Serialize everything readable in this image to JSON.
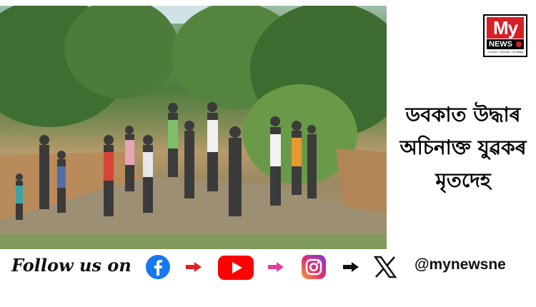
{
  "photo": {
    "icon": "news-photo-people-at-riverbank"
  },
  "logo": {
    "brand_top": "My",
    "brand_bottom": "NEWS",
    "tagline": "LOCAL • VOCAL • GLOBAL"
  },
  "headline": {
    "line1": "ডবকাত উদ্ধাৰ",
    "line2": "অচিনাক্ত যুৱকৰ",
    "line3": "মৃতদেহ"
  },
  "footer": {
    "follow_text": "Follow us on",
    "handle": "@mynewsne",
    "icons": [
      "facebook-icon",
      "youtube-icon",
      "instagram-icon",
      "x-icon"
    ],
    "colors": {
      "facebook": "#1877f2",
      "youtube": "#ff0000",
      "instagram": "#d6249f",
      "arrow_red": "#e02020",
      "arrow_pink": "#e0409a",
      "arrow_black": "#111111"
    }
  }
}
